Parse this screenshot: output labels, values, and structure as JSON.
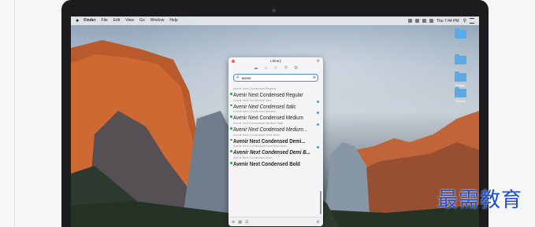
{
  "menubar": {
    "apple": "",
    "items": [
      "Finder",
      "File",
      "Edit",
      "View",
      "Go",
      "Window",
      "Help"
    ],
    "clock": "Thu 7:44 PM"
  },
  "desktop": {
    "icons": [
      {
        "label": ""
      },
      {
        "label": ""
      },
      {
        "label": "Google"
      },
      {
        "label": "Others"
      }
    ]
  },
  "window": {
    "title": "Library",
    "search_value": "avenir",
    "fonts": [
      {
        "label": "Avenir Next Condensed Regular",
        "name": "Avenir Next Condensed Regular",
        "style": "regular",
        "dot": false
      },
      {
        "label": "Avenir Next Condensed Italic",
        "name": "Avenir Next Condensed Italic",
        "style": "italic",
        "dot": true
      },
      {
        "label": "Avenir Next Condensed Medium",
        "name": "Avenir Next Condensed Medium",
        "style": "regular",
        "dot": true
      },
      {
        "label": "Avenir Next Condensed Medium Italic",
        "name": "Avenir Next Condensed Medium...",
        "style": "italic",
        "dot": true
      },
      {
        "label": "Avenir Next Condensed Demi Bold",
        "name": "Avenir Next Condensed Demi...",
        "style": "bold",
        "dot": false
      },
      {
        "label": "Avenir Next Condensed Demi Bold Italic",
        "name": "Avenir Next Condensed Demi B...",
        "style": "bold-italic",
        "dot": true
      },
      {
        "label": "Avenir Next Condensed Bold",
        "name": "Avenir Next Condensed Bold",
        "style": "bold",
        "dot": false
      }
    ]
  },
  "watermark": "最需教育",
  "icons": {
    "apple": "apple-logo-icon",
    "close": "close-dot",
    "pin": "pin-icon",
    "toolbar": [
      "cloud-icon",
      "home-icon",
      "star-icon",
      "search-icon",
      "gear-icon"
    ],
    "clear": "clear-icon",
    "bottom": [
      "add-icon",
      "grid-icon",
      "list-icon",
      "settings-icon"
    ]
  },
  "colors": {
    "accent": "#3c88e3",
    "close": "#fc5753",
    "active_dot": "#2fa84f",
    "watermark": "#1f4fc8"
  }
}
